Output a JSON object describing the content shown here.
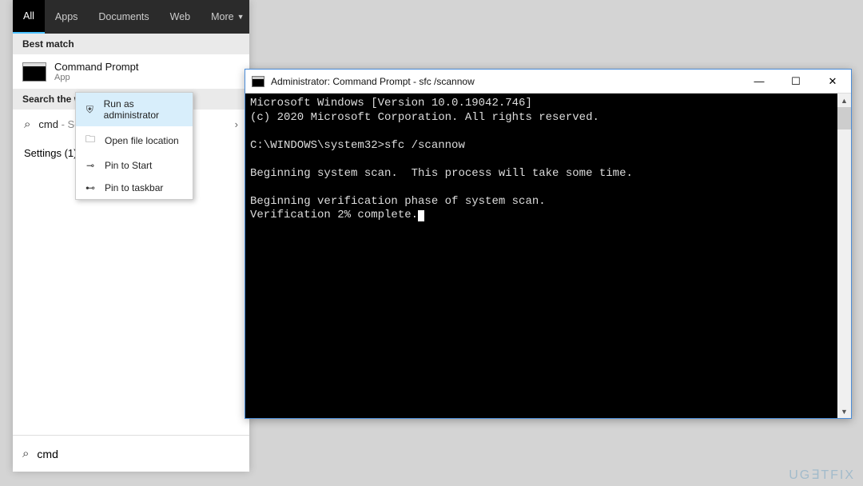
{
  "search": {
    "tabs": [
      "All",
      "Apps",
      "Documents",
      "Web",
      "More"
    ],
    "best_match_hdr": "Best match",
    "result_title": "Command Prompt",
    "result_sub": "App",
    "search_web_hdr": "Search the web",
    "web_query": "cmd",
    "web_suffix": "- Se",
    "settings_label": "Settings (1)",
    "input_value": "cmd"
  },
  "context": {
    "items": [
      {
        "icon": "⛨",
        "label": "Run as administrator",
        "hl": true
      },
      {
        "icon": "🗀",
        "label": "Open file location",
        "hl": false
      },
      {
        "icon": "⊸",
        "label": "Pin to Start",
        "hl": false
      },
      {
        "icon": "⊷",
        "label": "Pin to taskbar",
        "hl": false
      }
    ]
  },
  "cmd": {
    "title": "Administrator: Command Prompt - sfc  /scannow",
    "lines": [
      "Microsoft Windows [Version 10.0.19042.746]",
      "(c) 2020 Microsoft Corporation. All rights reserved.",
      "",
      "C:\\WINDOWS\\system32>sfc /scannow",
      "",
      "Beginning system scan.  This process will take some time.",
      "",
      "Beginning verification phase of system scan.",
      "Verification 2% complete."
    ]
  },
  "watermark": "UG∃TFIX"
}
